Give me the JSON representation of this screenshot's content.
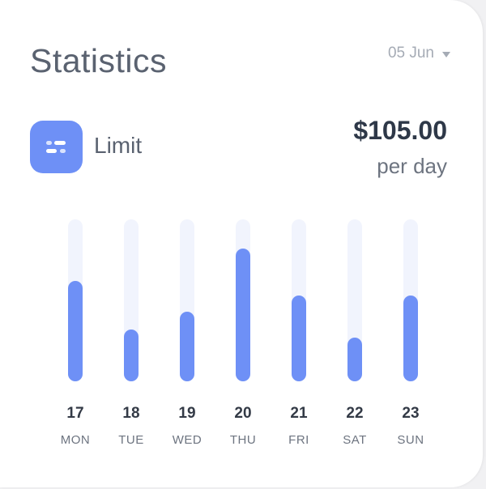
{
  "header": {
    "title": "Statistics",
    "date_select": "05 Jun"
  },
  "limit": {
    "label": "Limit",
    "amount": "$105.00",
    "period": "per day",
    "icon": "settings-sliders-icon"
  },
  "colors": {
    "accent": "#6e90f6",
    "track": "#f1f4fd",
    "title": "#5a6270",
    "amount": "#2e3848"
  },
  "chart_data": {
    "type": "bar",
    "categories": [
      "MON",
      "TUE",
      "WED",
      "THU",
      "FRI",
      "SAT",
      "SUN"
    ],
    "day_numbers": [
      "17",
      "18",
      "19",
      "20",
      "21",
      "22",
      "23"
    ],
    "values": [
      0.62,
      0.32,
      0.43,
      0.82,
      0.53,
      0.27,
      0.53
    ],
    "ylim": [
      0,
      1
    ],
    "grid": false
  }
}
